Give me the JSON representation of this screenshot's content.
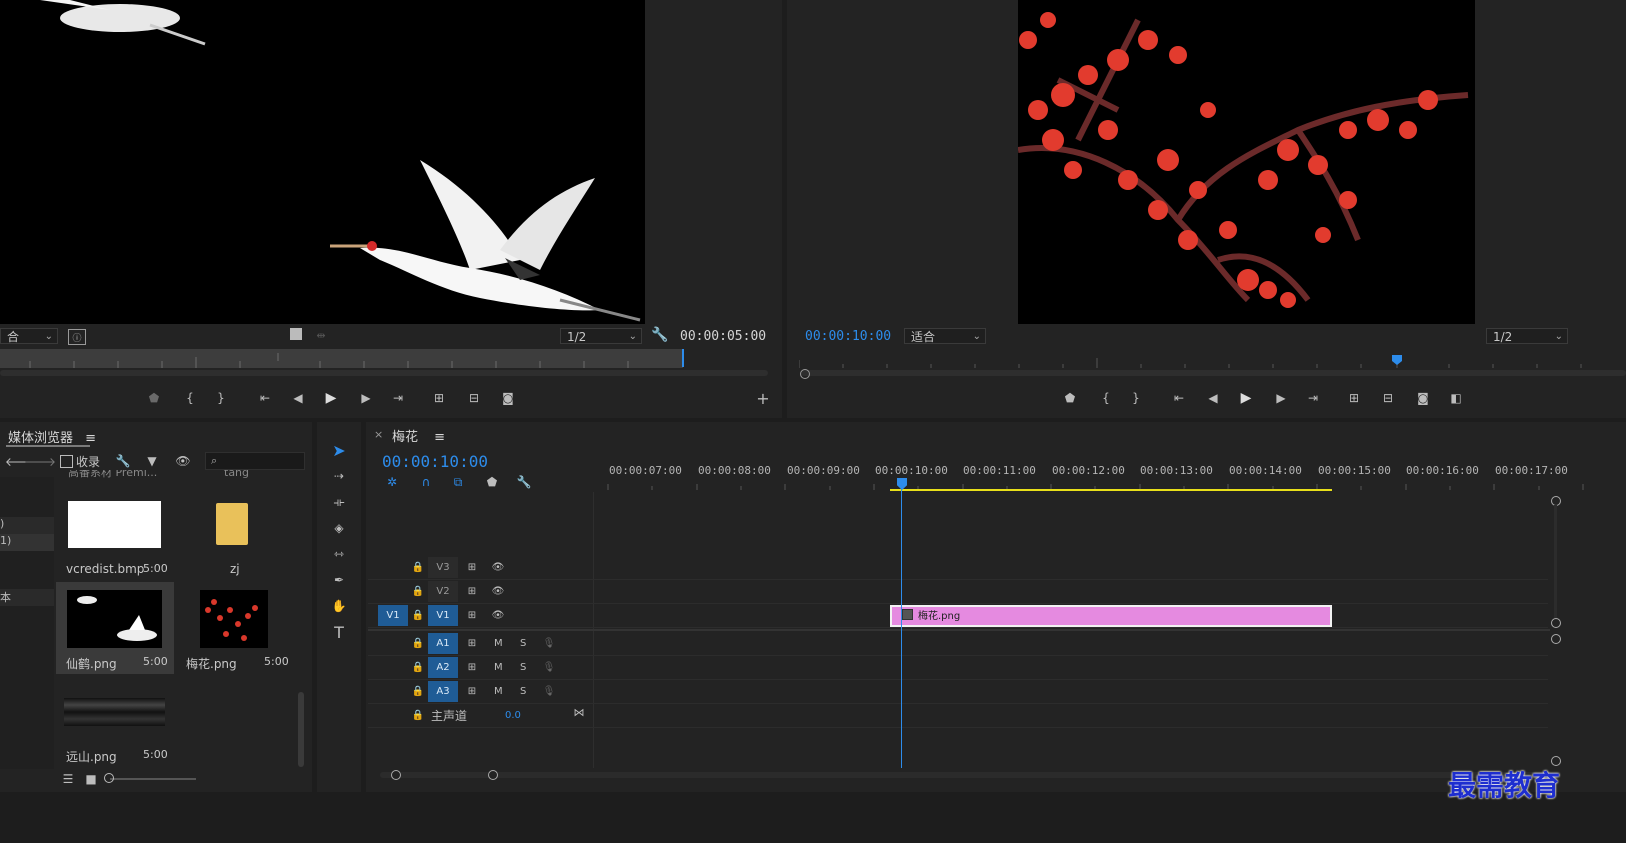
{
  "colors": {
    "timecode_blue": "#2d8ceb",
    "clip_pink": "#e58ae0",
    "track_active": "#1f5c96",
    "workarea_yellow": "#e8df1a",
    "watermark_blue": "#1e2ecf"
  },
  "source_monitor": {
    "zoom_label": "合",
    "quality": "1/2",
    "timecode": "00:00:05:00"
  },
  "program_monitor": {
    "timecode": "00:00:10:00",
    "zoom_label": "适合",
    "quality": "1/2"
  },
  "media_browser": {
    "title": "媒体浏览器",
    "favorites_label": "收录",
    "search_placeholder": "",
    "left_items": [
      ")",
      "1)",
      "本"
    ],
    "items": [
      {
        "name": "vcredist.bmp",
        "duration": "5:00",
        "thumb": "white"
      },
      {
        "name": "zj",
        "duration": "",
        "thumb": "folder"
      },
      {
        "name": "仙鹤.png",
        "duration": "5:00",
        "thumb": "crane"
      },
      {
        "name": "梅花.png",
        "duration": "5:00",
        "thumb": "plum"
      },
      {
        "name": "远山.png",
        "duration": "5:00",
        "thumb": "mountain"
      }
    ],
    "partial_top_left": "高番系材 Premi...",
    "partial_top_right": "tang"
  },
  "timeline": {
    "tab_label": "梅花",
    "timecode": "00:00:10:00",
    "ruler_times": [
      "00:00:07:00",
      "00:00:08:00",
      "00:00:09:00",
      "00:00:10:00",
      "00:00:11:00",
      "00:00:12:00",
      "00:00:13:00",
      "00:00:14:00",
      "00:00:15:00",
      "00:00:16:00",
      "00:00:17:00"
    ],
    "video_tracks": [
      "V3",
      "V2",
      "V1"
    ],
    "source_patch_v": "V1",
    "audio_tracks": [
      "A1",
      "A2",
      "A3"
    ],
    "mute_label": "M",
    "solo_label": "S",
    "master_label": "主声道",
    "master_value": "0.0",
    "clip_label": "梅花.png"
  },
  "watermark": "最需教育"
}
